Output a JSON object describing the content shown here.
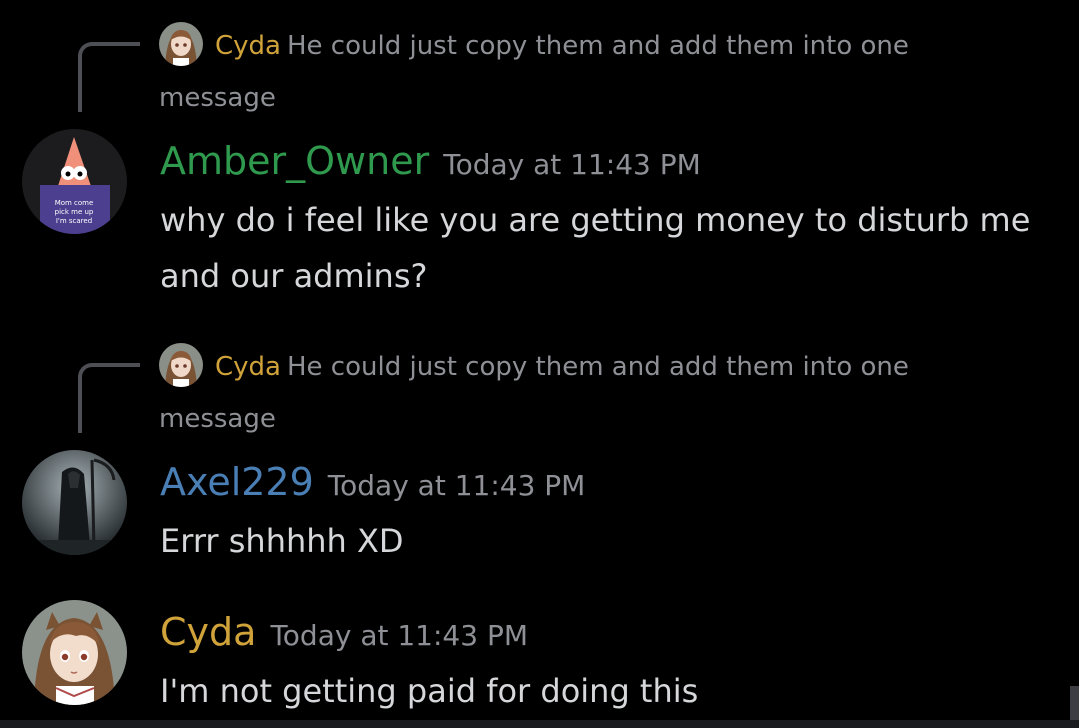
{
  "colors": {
    "background": "#000000",
    "owner_green": "#2f9a4d",
    "axel_blue": "#4a7fb5",
    "cyda_gold": "#d0a33a",
    "muted_text": "#8e9096",
    "message_text": "#d6d7da",
    "reply_line": "#4e4f54"
  },
  "messages": [
    {
      "reply": {
        "author": "Cyda",
        "text": "He could just copy them and add them into one message",
        "avatar_icon": "anime-girl-avatar"
      },
      "author": "Amber_Owner",
      "author_color": "#2f9a4d",
      "timestamp": "Today at 11:43 PM",
      "content": "why do i feel like you are getting money to disturb me and our admins?",
      "avatar_icon": "patrick-star-avatar",
      "avatar_caption": "Mom come pick me up I'm scared"
    },
    {
      "reply": {
        "author": "Cyda",
        "text": "He could just copy them and add them into one message",
        "avatar_icon": "anime-girl-avatar"
      },
      "author": "Axel229",
      "author_color": "#4a7fb5",
      "timestamp": "Today at 11:43 PM",
      "content": "Errr shhhhh XD",
      "avatar_icon": "dark-reaper-avatar"
    },
    {
      "author": "Cyda",
      "author_color": "#d0a33a",
      "timestamp": "Today at 11:43 PM",
      "content": "I'm not getting paid for doing this",
      "avatar_icon": "anime-girl-avatar"
    }
  ]
}
